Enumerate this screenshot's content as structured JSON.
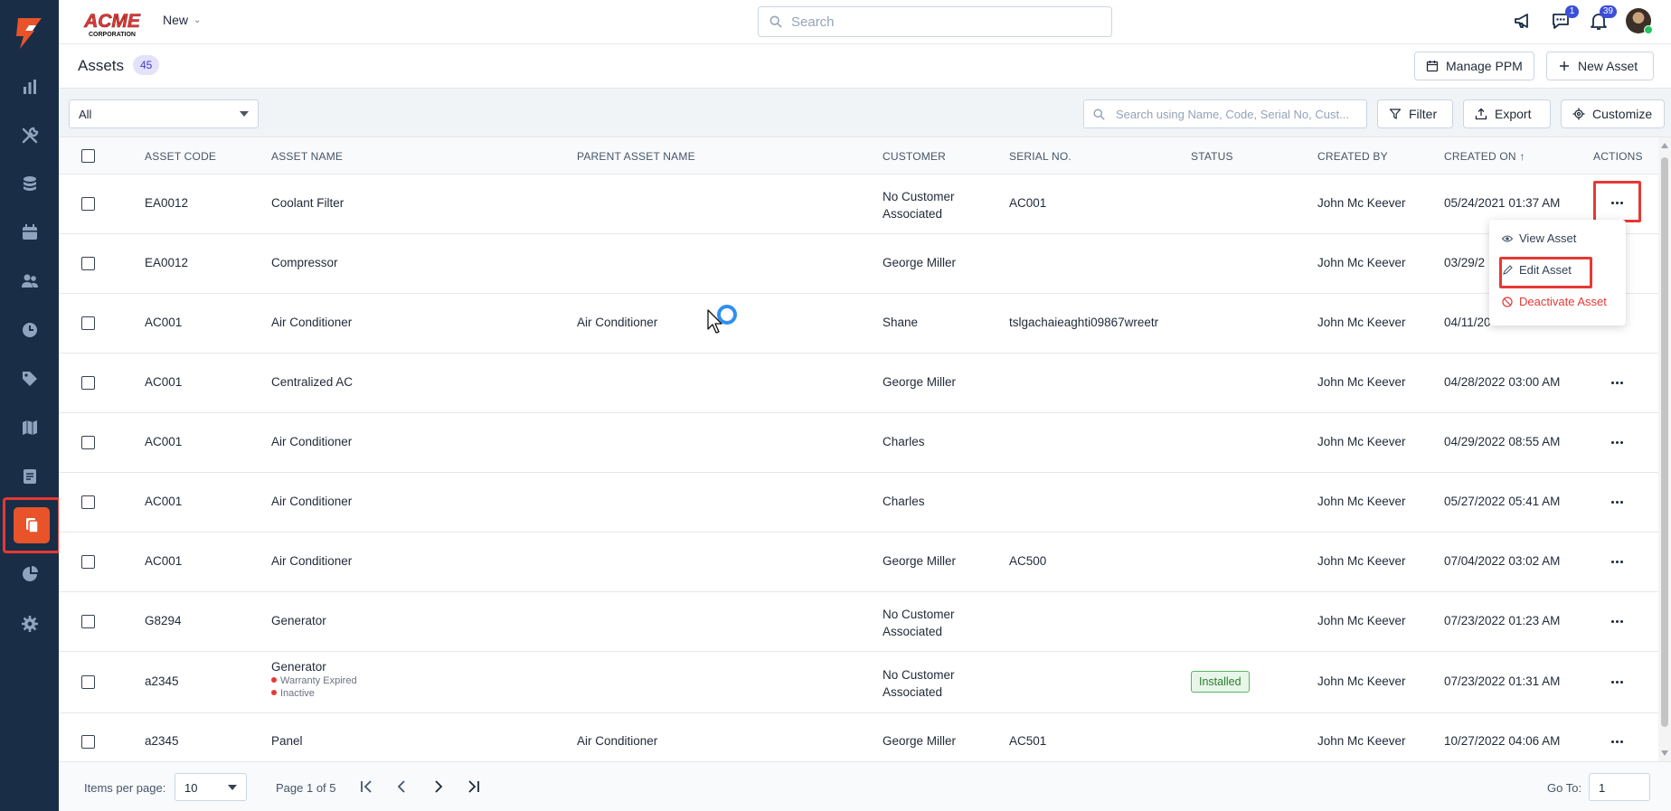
{
  "brand": {
    "name": "ACME",
    "tagline": "CORPORATION"
  },
  "topbar": {
    "new_label": "New",
    "search_placeholder": "Search",
    "chat_badge": "1",
    "notif_badge": "39"
  },
  "page": {
    "title": "Assets",
    "count": "45",
    "manage_ppm_label": "Manage PPM",
    "new_asset_label": "New Asset"
  },
  "filter_bar": {
    "view_select": "All",
    "search_placeholder": "Search using Name, Code, Serial No, Cust...",
    "filter_label": "Filter",
    "export_label": "Export",
    "customize_label": "Customize"
  },
  "table": {
    "headers": {
      "code": "ASSET CODE",
      "name": "ASSET NAME",
      "parent": "PARENT ASSET NAME",
      "customer": "CUSTOMER",
      "serial": "SERIAL NO.",
      "status": "STATUS",
      "created_by": "CREATED BY",
      "created_on": "CREATED ON",
      "actions": "ACTIONS"
    },
    "rows": [
      {
        "code": "EA0012",
        "name": "Coolant Filter",
        "parent": "",
        "customer_line1": "No Customer",
        "customer_line2": "Associated",
        "serial": "AC001",
        "status": "",
        "created_by": "John Mc Keever",
        "created_on": "05/24/2021 01:37 AM"
      },
      {
        "code": "EA0012",
        "name": "Compressor",
        "parent": "",
        "customer_line1": "George Miller",
        "customer_line2": "",
        "serial": "",
        "status": "",
        "created_by": "John Mc Keever",
        "created_on": "03/29/2"
      },
      {
        "code": "AC001",
        "name": "Air Conditioner",
        "parent": "Air Conditioner",
        "customer_line1": "Shane",
        "customer_line2": "",
        "serial": "tslgachaieaghti09867wreetr",
        "status": "",
        "created_by": "John Mc Keever",
        "created_on": "04/11/20"
      },
      {
        "code": "AC001",
        "name": "Centralized AC",
        "parent": "",
        "customer_line1": "George Miller",
        "customer_line2": "",
        "serial": "",
        "status": "",
        "created_by": "John Mc Keever",
        "created_on": "04/28/2022 03:00 AM"
      },
      {
        "code": "AC001",
        "name": "Air Conditioner",
        "parent": "",
        "customer_line1": "Charles",
        "customer_line2": "",
        "serial": "",
        "status": "",
        "created_by": "John Mc Keever",
        "created_on": "04/29/2022 08:55 AM"
      },
      {
        "code": "AC001",
        "name": "Air Conditioner",
        "parent": "",
        "customer_line1": "Charles",
        "customer_line2": "",
        "serial": "",
        "status": "",
        "created_by": "John Mc Keever",
        "created_on": "05/27/2022 05:41 AM"
      },
      {
        "code": "AC001",
        "name": "Air Conditioner",
        "parent": "",
        "customer_line1": "George Miller",
        "customer_line2": "",
        "serial": "AC500",
        "status": "",
        "created_by": "John Mc Keever",
        "created_on": "07/04/2022 03:02 AM"
      },
      {
        "code": "G8294",
        "name": "Generator",
        "parent": "",
        "customer_line1": "No Customer",
        "customer_line2": "Associated",
        "serial": "",
        "status": "",
        "created_by": "John Mc Keever",
        "created_on": "07/23/2022 01:23 AM"
      },
      {
        "code": "a2345",
        "name": "Generator",
        "tag1": "Warranty Expired",
        "tag2": "Inactive",
        "parent": "",
        "customer_line1": "No Customer",
        "customer_line2": "Associated",
        "serial": "",
        "status": "Installed",
        "created_by": "John Mc Keever",
        "created_on": "07/23/2022 01:31 AM"
      },
      {
        "code": "a2345",
        "name": "Panel",
        "parent": "Air Conditioner",
        "customer_line1": "George Miller",
        "customer_line2": "",
        "serial": "AC501",
        "status": "",
        "created_by": "John Mc Keever",
        "created_on": "10/27/2022 04:06 AM"
      }
    ]
  },
  "row_menu": {
    "view": "View Asset",
    "edit": "Edit Asset",
    "deactivate": "Deactivate Asset"
  },
  "footer": {
    "items_per_page_label": "Items per page:",
    "items_per_page": "10",
    "page_info": "Page 1 of 5",
    "goto_label": "Go To:",
    "goto_value": "1"
  },
  "colors": {
    "sidebar_bg": "#1a2d46",
    "accent": "#e8532a",
    "highlight": "#e53935",
    "badge": "#3b4fd8"
  }
}
